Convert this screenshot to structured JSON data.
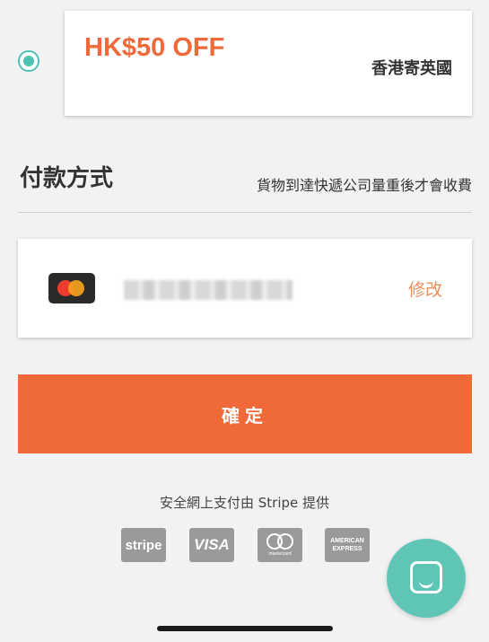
{
  "coupon": {
    "amount": "HK$50 OFF",
    "description": "香港寄英國",
    "selected": true
  },
  "payment": {
    "section_title": "付款方式",
    "section_note": "貨物到達快遞公司量重後才會收費",
    "card_brand_icon": "mastercard-icon",
    "edit_label": "修改"
  },
  "confirm_label": "確定",
  "secure": {
    "text": "安全網上支付由 Stripe 提供",
    "logos": [
      {
        "name": "stripe-logo",
        "label": "stripe"
      },
      {
        "name": "visa-logo",
        "label": "VISA"
      },
      {
        "name": "mastercard-logo",
        "label": "mastercard"
      },
      {
        "name": "amex-logo",
        "label_line1": "AMERICAN",
        "label_line2": "EXPRESS"
      }
    ]
  },
  "chat": {
    "icon": "chat-icon"
  },
  "colors": {
    "accent": "#ef6a38",
    "teal": "#5fc6b5",
    "radio": "#4cc3b5",
    "edit_link": "#ee8c5c"
  }
}
